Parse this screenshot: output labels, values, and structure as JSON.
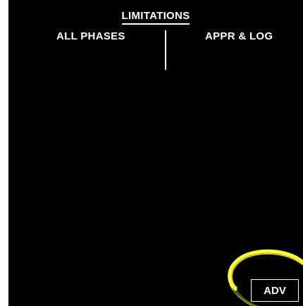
{
  "page": {
    "title": "LIMITATIONS"
  },
  "columns": {
    "left_label": "ALL PHASES",
    "right_label": "APPR & LOG"
  },
  "buttons": {
    "adv_label": "ADV"
  },
  "colors": {
    "background": "#000000",
    "text": "#ffffff",
    "highlight": "#ffff33"
  }
}
